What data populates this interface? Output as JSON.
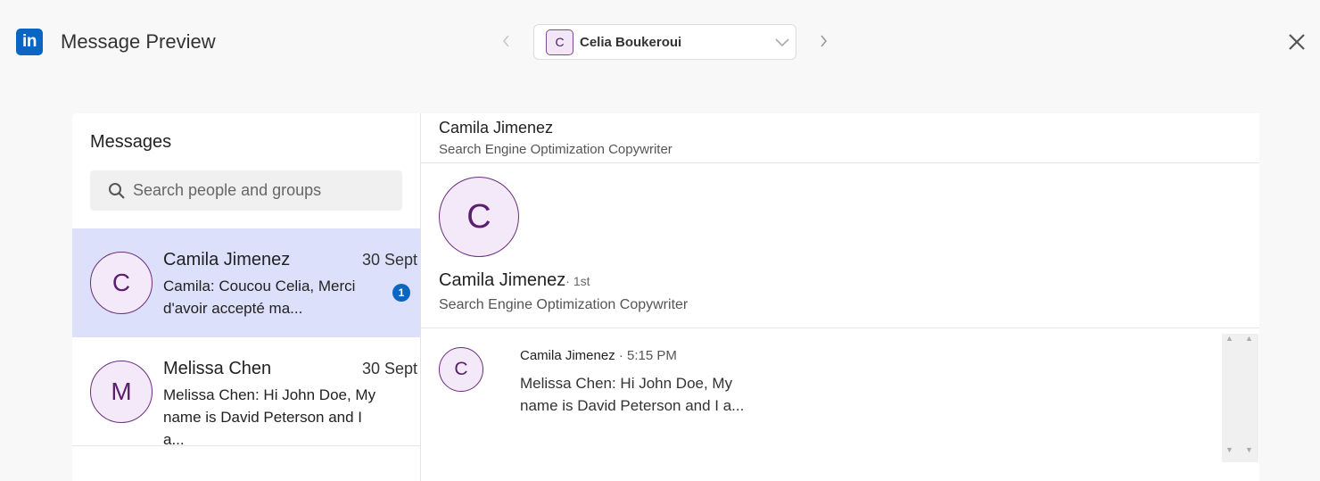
{
  "header": {
    "logo_text": "in",
    "title": "Message Preview",
    "prev_icon": "chevron-left-icon",
    "next_icon": "chevron-right-icon",
    "account": {
      "initial": "C",
      "name": "Celia Boukeroui"
    },
    "close_icon": "close-icon"
  },
  "sidebar": {
    "title": "Messages",
    "search": {
      "placeholder": "Search people and groups",
      "value": ""
    },
    "conversations": [
      {
        "initial": "C",
        "name": "Camila Jimenez",
        "date": "30 Sept",
        "preview": "Camila: Coucou Celia, Merci d'avoir accepté ma...",
        "unread": "1",
        "selected": true
      },
      {
        "initial": "M",
        "name": "Melissa Chen",
        "date": "30 Sept",
        "preview": "Melissa Chen: Hi John Doe, My name is David Peterson and I a...",
        "selected": false
      }
    ]
  },
  "conversation": {
    "header": {
      "name": "Camila Jimenez",
      "title": "Search Engine Optimization Copywriter"
    },
    "profile": {
      "initial": "C",
      "name": "Camila Jimenez",
      "degree": "· 1st",
      "title": "Search Engine Optimization Copywriter"
    },
    "messages": [
      {
        "initial": "C",
        "sender": "Camila Jimenez",
        "time": "· 5:15 PM",
        "body": "Melissa Chen: Hi John Doe, My name is David Peterson and I a..."
      }
    ]
  },
  "colors": {
    "linkedin_blue": "#0a66c2",
    "selected_bg": "#dde0fa",
    "avatar_purple": "#6b2d7e"
  }
}
